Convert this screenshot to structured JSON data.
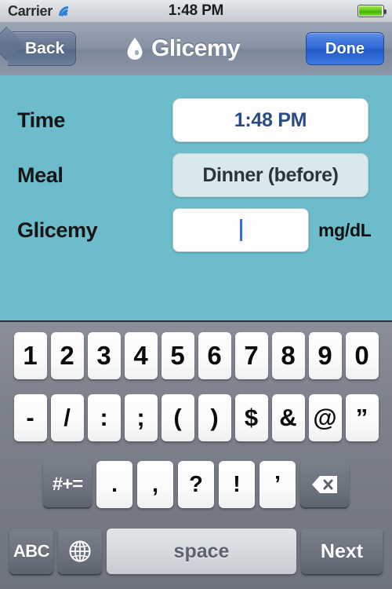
{
  "status_bar": {
    "carrier": "Carrier",
    "wifi_icon": "wifi-icon",
    "time": "1:48 PM",
    "battery_icon": "battery-full-icon"
  },
  "navbar": {
    "back_label": "Back",
    "title_icon": "water-drop-icon",
    "title": "Glicemy",
    "done_label": "Done"
  },
  "form": {
    "background_color": "#6CBCCB",
    "rows": [
      {
        "label": "Time",
        "value": "1:48 PM",
        "unit": ""
      },
      {
        "label": "Meal",
        "value": "Dinner (before)",
        "unit": ""
      },
      {
        "label": "Glicemy",
        "value": "",
        "unit": "mg/dL"
      }
    ]
  },
  "keyboard": {
    "row1": [
      "1",
      "2",
      "3",
      "4",
      "5",
      "6",
      "7",
      "8",
      "9",
      "0"
    ],
    "row2": [
      "-",
      "/",
      ":",
      ";",
      "(",
      ")",
      "$",
      "&",
      "@",
      "”"
    ],
    "row3": {
      "symbols_label": "#+=",
      "keys": [
        ".",
        ",",
        "?",
        "!",
        "’"
      ],
      "backspace_icon": "backspace-icon"
    },
    "row4": {
      "abc_label": "ABC",
      "globe_icon": "globe-icon",
      "space_label": "space",
      "next_label": "Next"
    }
  }
}
